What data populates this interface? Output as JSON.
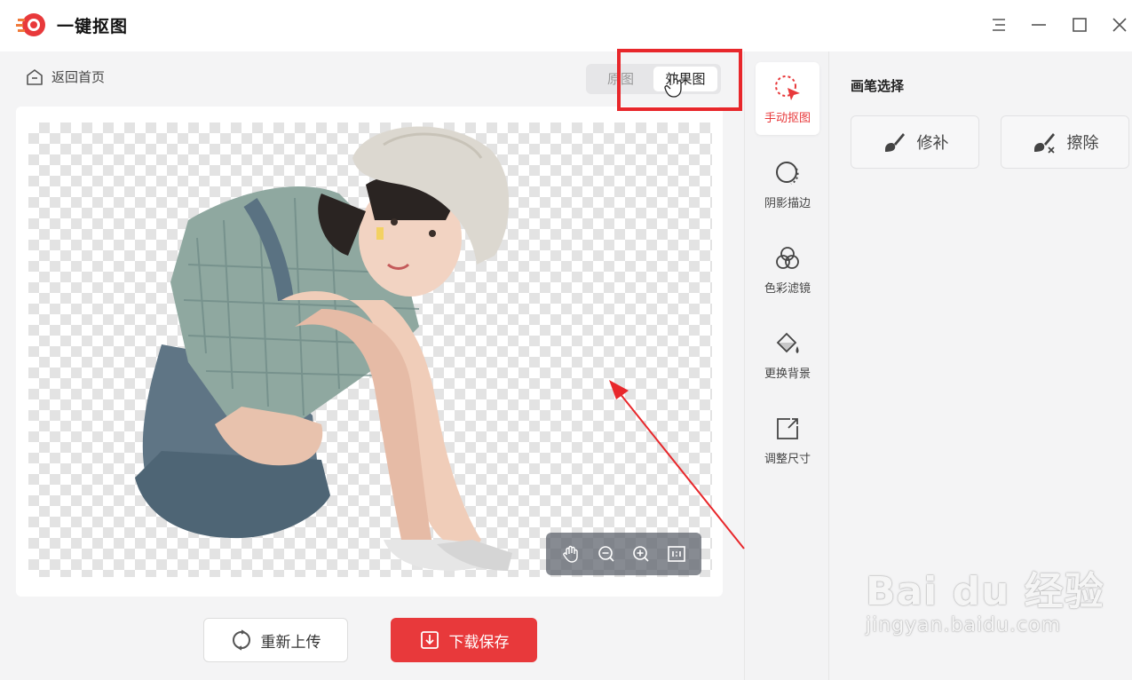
{
  "window": {
    "title": "一键抠图",
    "controls": [
      "menu-icon",
      "minimize-icon",
      "maximize-icon",
      "close-icon"
    ]
  },
  "nav": {
    "back_label": "返回首页"
  },
  "view_toggle": {
    "original": "原图",
    "result": "效果图",
    "active": "效果图"
  },
  "zoom_tools": [
    "hand-icon",
    "zoom-out-icon",
    "zoom-in-icon",
    "actual-size-icon"
  ],
  "actions": {
    "reupload": "重新上传",
    "save": "下载保存"
  },
  "tools": [
    {
      "label": "手动抠图",
      "icon": "manual-cutout-icon",
      "active": true
    },
    {
      "label": "阴影描边",
      "icon": "shadow-outline-icon",
      "active": false
    },
    {
      "label": "色彩滤镜",
      "icon": "color-filter-icon",
      "active": false
    },
    {
      "label": "更换背景",
      "icon": "change-background-icon",
      "active": false
    },
    {
      "label": "调整尺寸",
      "icon": "resize-icon",
      "active": false
    }
  ],
  "brush_panel": {
    "title": "画笔选择",
    "buttons": [
      {
        "label": "修补",
        "icon": "repair-brush-icon"
      },
      {
        "label": "擦除",
        "icon": "erase-brush-icon"
      }
    ]
  },
  "watermark": {
    "main": "Bai du 经验",
    "sub": "jingyan.baidu.com"
  },
  "colors": {
    "accent": "#e8393b",
    "highlight": "#e8272b",
    "panel_bg": "#f4f4f5"
  }
}
